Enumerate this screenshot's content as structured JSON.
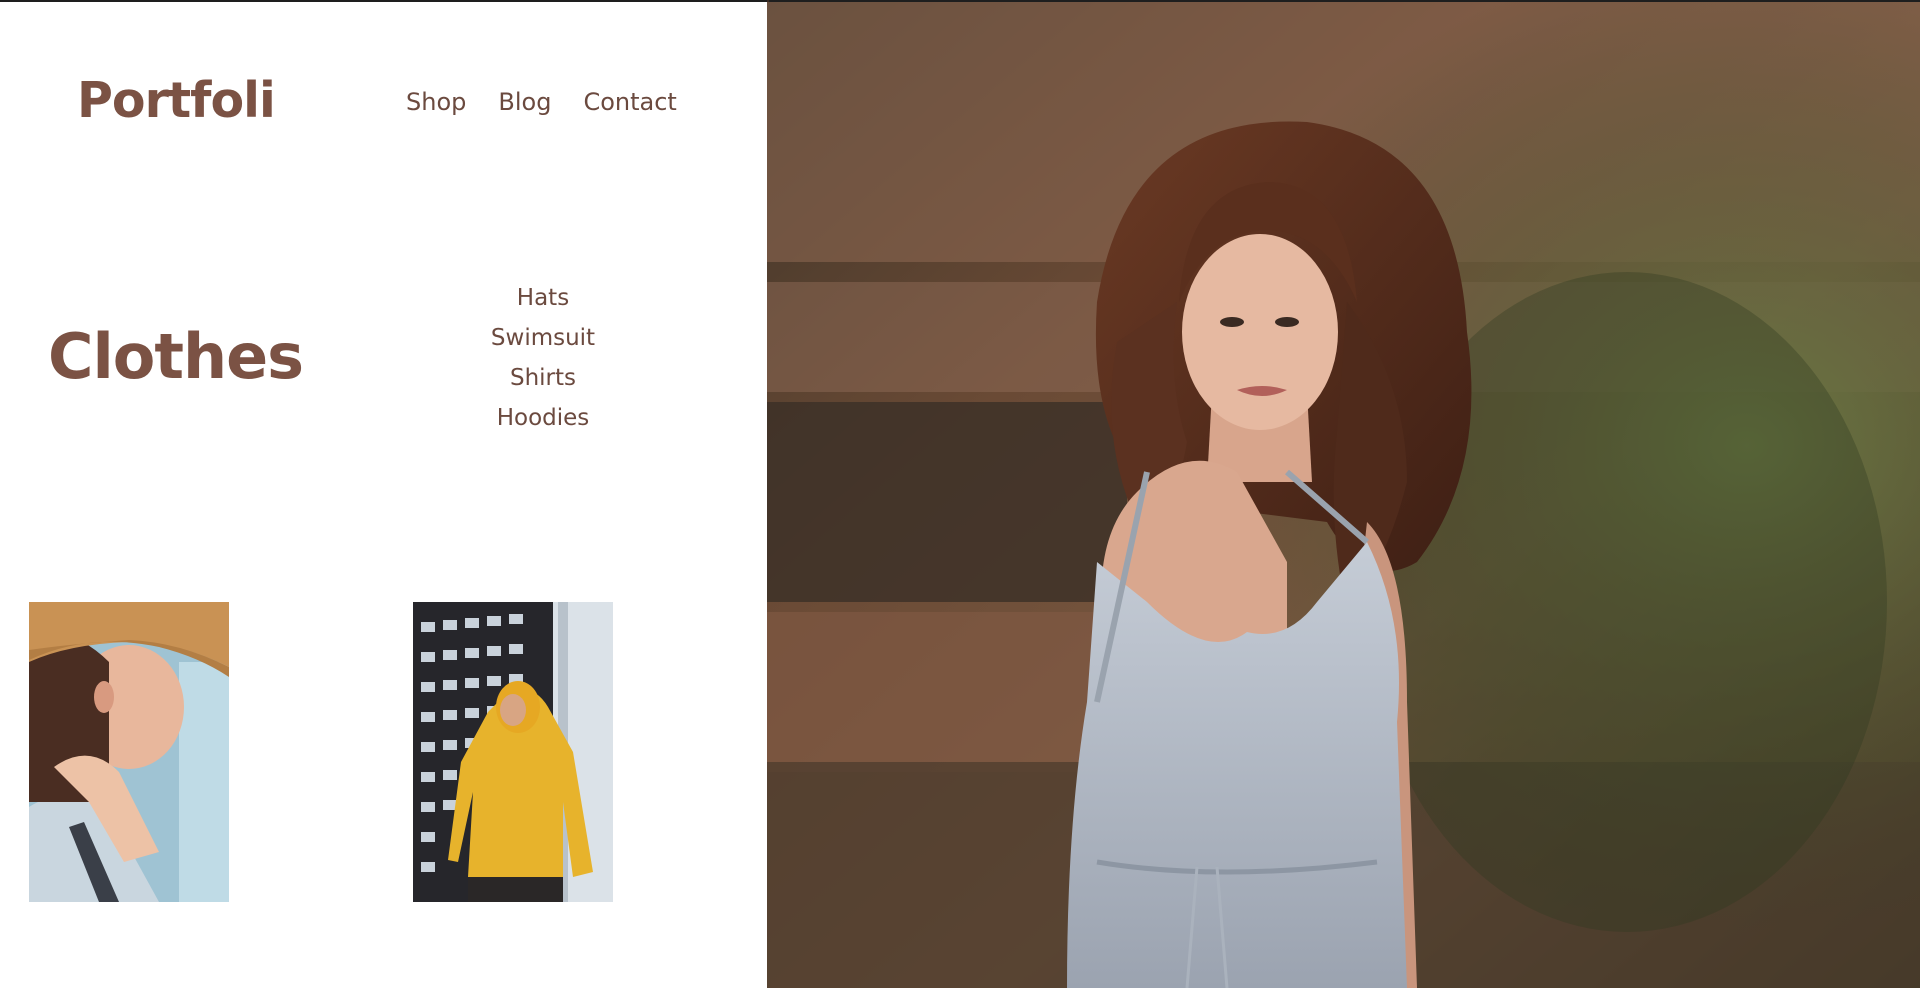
{
  "brand": {
    "logo": "Portfoli"
  },
  "nav": {
    "items": [
      "Shop",
      "Blog",
      "Contact"
    ]
  },
  "section": {
    "title": "Clothes",
    "categories": [
      "Hats",
      "Swimsuit",
      "Shirts",
      "Hoodies"
    ]
  },
  "colors": {
    "accent": "#7b5244",
    "text": "#6b4a3f",
    "background": "#ffffff"
  },
  "images": {
    "thumb1": "woman-with-straw-hat-photo",
    "thumb2": "man-in-yellow-hoodie-photo",
    "hero": "woman-in-grey-dress-photo"
  }
}
